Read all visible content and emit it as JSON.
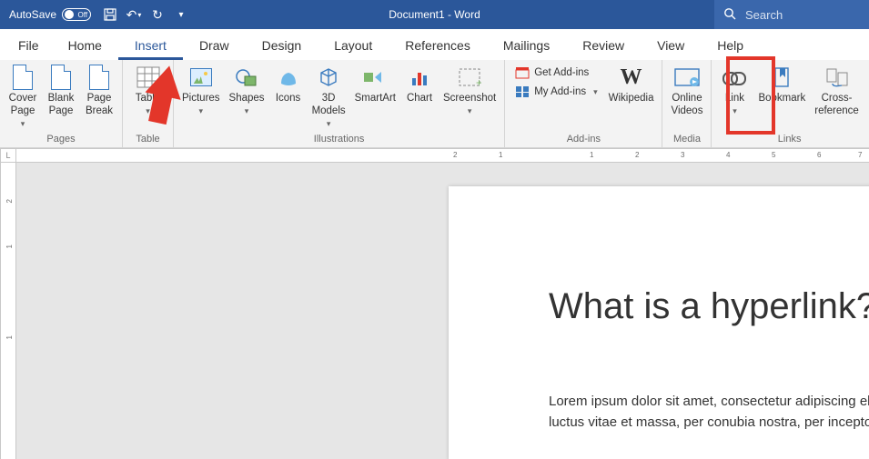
{
  "title_bar": {
    "autosave_label": "AutoSave",
    "autosave_state": "Off",
    "document_title": "Document1 - Word",
    "search_placeholder": "Search"
  },
  "tabs": {
    "file": "File",
    "home": "Home",
    "insert": "Insert",
    "draw": "Draw",
    "design": "Design",
    "layout": "Layout",
    "references": "References",
    "mailings": "Mailings",
    "review": "Review",
    "view": "View",
    "help": "Help"
  },
  "ribbon": {
    "pages": {
      "label": "Pages",
      "cover": "Cover\nPage",
      "blank": "Blank\nPage",
      "break": "Page\nBreak"
    },
    "tables": {
      "label": "Table",
      "table": "Table"
    },
    "illustrations": {
      "label": "Illustrations",
      "pictures": "Pictures",
      "shapes": "Shapes",
      "icons": "Icons",
      "models3d": "3D\nModels",
      "smartart": "SmartArt",
      "chart": "Chart",
      "screenshot": "Screenshot"
    },
    "addins": {
      "label": "Add-ins",
      "get": "Get Add-ins",
      "my": "My Add-ins",
      "wikipedia": "Wikipedia"
    },
    "media": {
      "label": "Media",
      "video": "Online\nVideos"
    },
    "links": {
      "label": "Links",
      "link": "Link",
      "bookmark": "Bookmark",
      "crossref": "Cross-\nreference"
    }
  },
  "ruler": {
    "h": [
      "2",
      "1",
      "1",
      "2",
      "3",
      "4",
      "5",
      "6",
      "7"
    ],
    "v": [
      "2",
      "1",
      "1"
    ]
  },
  "document": {
    "heading": "What is a hyperlink?",
    "body": "Lorem ipsum dolor sit amet, consectetur adipiscing elit. Quisque a sem eu eros ultrices luctus vitae et massa, per conubia nostra, per inceptos himenaeos."
  }
}
